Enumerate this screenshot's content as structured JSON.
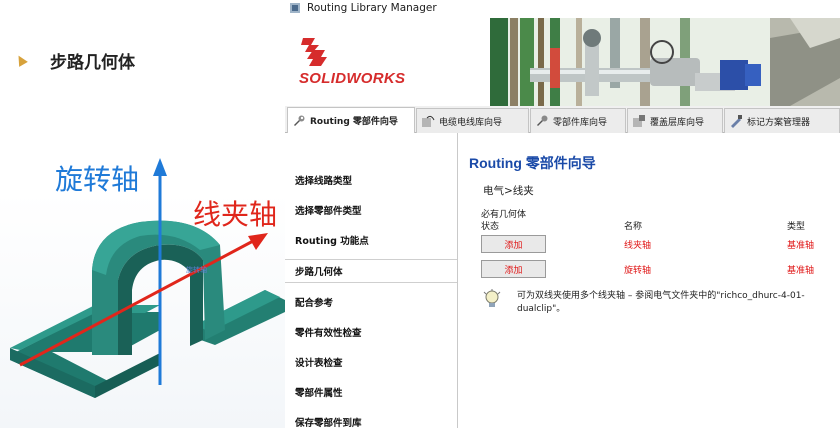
{
  "slide": {
    "title": "步路几何体",
    "rotation_axis_label": "旋转轴",
    "clip_axis_label": "线夹轴",
    "model_axis_tag": "旋转轴"
  },
  "window": {
    "title": "Routing Library Manager",
    "brand": "SOLIDWORKS",
    "tabs": [
      {
        "label": "Routing 零部件向导",
        "active": true
      },
      {
        "label": "电缆电线库向导",
        "active": false
      },
      {
        "label": "零部件库向导",
        "active": false
      },
      {
        "label": "覆盖层库向导",
        "active": false
      },
      {
        "label": "标记方案管理器",
        "active": false
      }
    ]
  },
  "nav": {
    "items": [
      {
        "label": "选择线路类型"
      },
      {
        "label": "选择零部件类型"
      },
      {
        "label": "Routing 功能点"
      },
      {
        "label": "步路几何体"
      },
      {
        "label": "配合参考"
      },
      {
        "label": "零件有效性检查"
      },
      {
        "label": "设计表检查"
      },
      {
        "label": "零部件属性"
      },
      {
        "label": "保存零部件到库"
      }
    ],
    "selected_index": 3
  },
  "content": {
    "heading": "Routing 零部件向导",
    "breadcrumb": "电气>线夹",
    "required_geometry_label": "必有几何体",
    "columns": {
      "status": "状态",
      "name": "名称",
      "type": "类型"
    },
    "rows": [
      {
        "button": "添加",
        "name": "线夹轴",
        "type": "基准轴"
      },
      {
        "button": "添加",
        "name": "旋转轴",
        "type": "基准轴"
      }
    ],
    "tip": "可为双线夹使用多个线夹轴 – 参阅电气文件夹中的\"richco_dhurc-4-01-dualclip\"。"
  },
  "colors": {
    "accent_blue": "#1a4aa8",
    "error_red": "#e01818",
    "axis_blue": "#1f7ad8",
    "axis_red": "#e0261b",
    "model_teal": "#2a8a7d"
  }
}
